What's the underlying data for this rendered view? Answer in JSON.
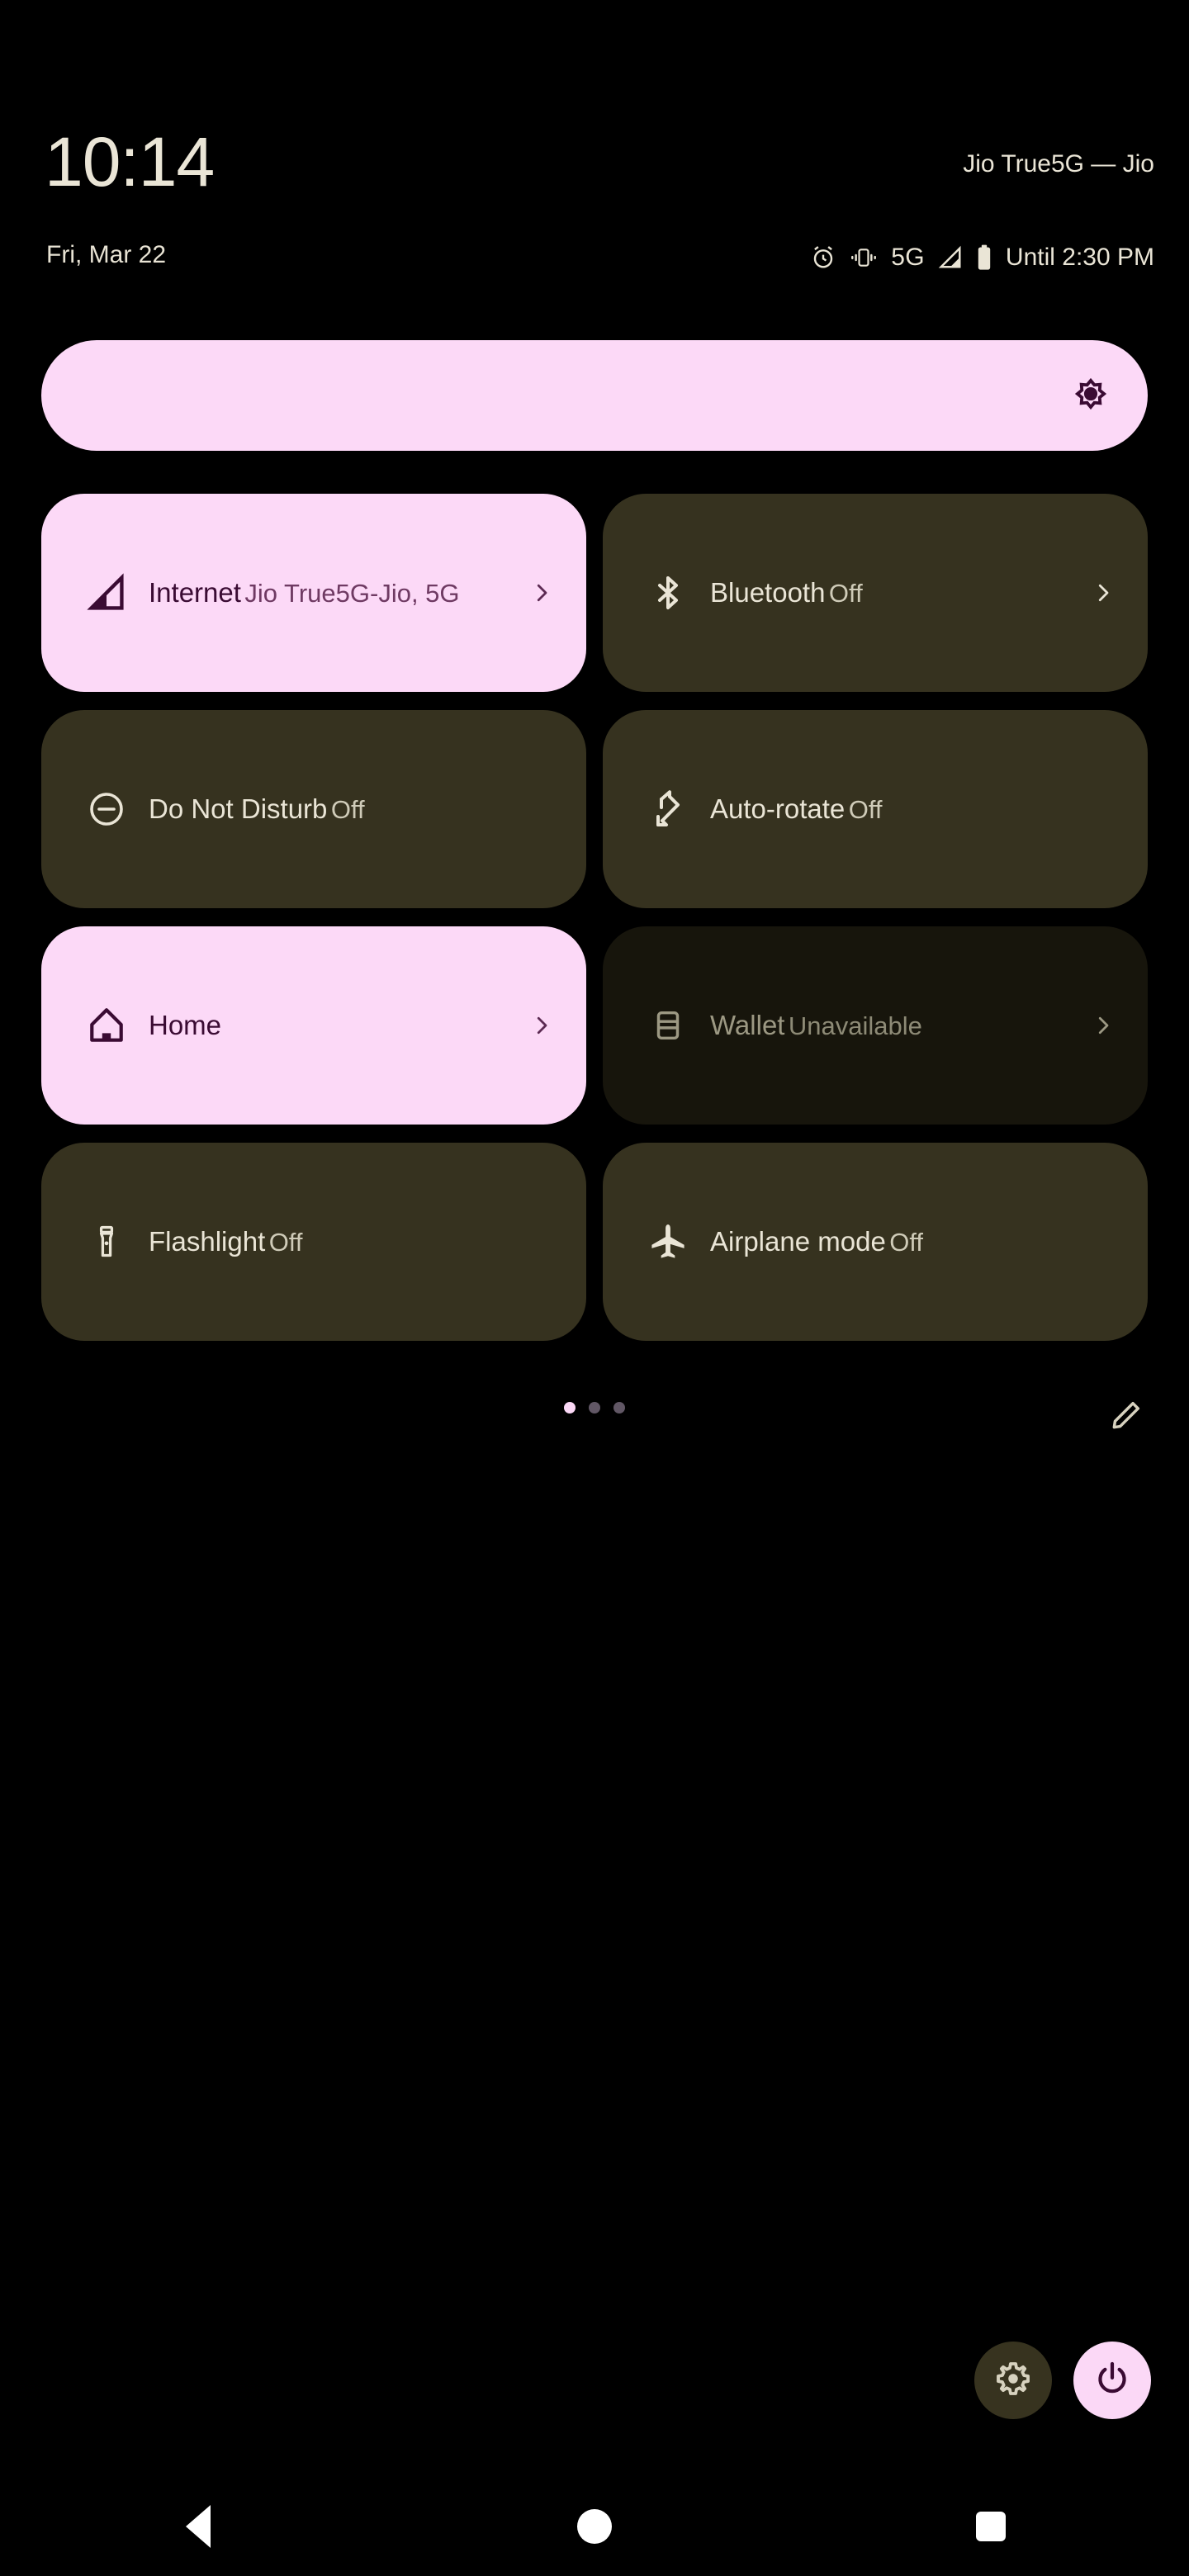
{
  "statusbar": {
    "clock": "10:14",
    "date": "Fri, Mar 22",
    "carrier": "Jio True5G — Jio",
    "network_type": "5G",
    "battery_status": "Until 2:30 PM",
    "icons": [
      "alarm-icon",
      "vibrate-icon",
      "signal-icon",
      "battery-icon"
    ]
  },
  "brightness": {
    "icon": "brightness-icon",
    "level_percent": 100,
    "fill_color": "#fcd9f7"
  },
  "tiles": [
    {
      "label": "Internet",
      "sub": "Jio True5G-Jio, 5G",
      "icon": "signal-cellular-icon",
      "state": "active",
      "chevron": true,
      "name": "quick-tile-internet"
    },
    {
      "label": "Bluetooth",
      "sub": "Off",
      "icon": "bluetooth-icon",
      "state": "inactive",
      "chevron": true,
      "name": "quick-tile-bluetooth"
    },
    {
      "label": "Do Not Disturb",
      "sub": "Off",
      "icon": "do-not-disturb-icon",
      "state": "inactive",
      "chevron": false,
      "name": "quick-tile-do-not-disturb"
    },
    {
      "label": "Auto-rotate",
      "sub": "Off",
      "icon": "auto-rotate-icon",
      "state": "inactive",
      "chevron": false,
      "name": "quick-tile-auto-rotate"
    },
    {
      "label": "Home",
      "sub": "",
      "icon": "home-icon",
      "state": "active",
      "chevron": true,
      "name": "quick-tile-home"
    },
    {
      "label": "Wallet",
      "sub": "Unavailable",
      "icon": "wallet-card-icon",
      "state": "disabled",
      "chevron": true,
      "name": "quick-tile-wallet"
    },
    {
      "label": "Flashlight",
      "sub": "Off",
      "icon": "flashlight-icon",
      "state": "inactive",
      "chevron": false,
      "name": "quick-tile-flashlight"
    },
    {
      "label": "Airplane mode",
      "sub": "Off",
      "icon": "airplane-icon",
      "state": "inactive",
      "chevron": false,
      "name": "quick-tile-airplane-mode"
    }
  ],
  "pager": {
    "pages": 3,
    "current_page": 1,
    "edit_icon": "pencil-edit-icon"
  },
  "footer": {
    "settings_icon": "gear-icon",
    "power_icon": "power-icon"
  },
  "navbar": {
    "back": "back-icon",
    "home": "home-nav-icon",
    "recents": "recents-icon"
  },
  "colors": {
    "background": "#000000",
    "accent_pink": "#fcd9f7",
    "accent_pink_dark": "#3a0b33",
    "tile_inactive": "#36321f",
    "tile_disabled": "#17150c",
    "text_cream": "#eae5d6"
  }
}
